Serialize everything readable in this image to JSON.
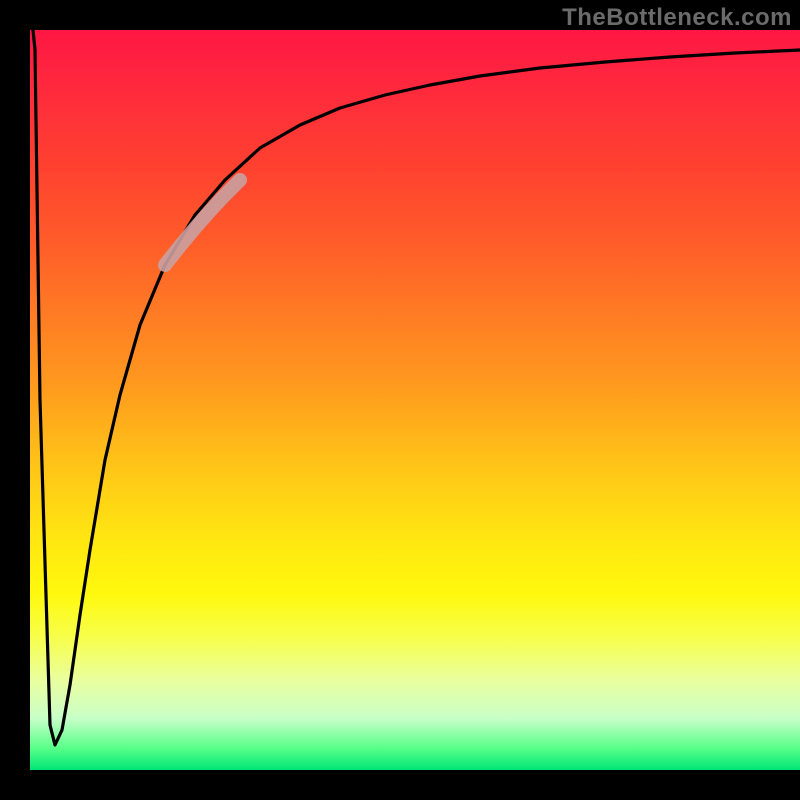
{
  "brand": {
    "watermark": "TheBottleneck.com"
  },
  "colors": {
    "background": "#000000",
    "curve": "#000000",
    "highlight": "#caa0a0",
    "gradient_top": "#ff1744",
    "gradient_mid": "#ffeb3b",
    "gradient_bottom": "#00e676"
  },
  "chart_data": {
    "type": "line",
    "title": "",
    "xlabel": "",
    "ylabel": "",
    "xlim": [
      0,
      100
    ],
    "ylim": [
      0,
      100
    ],
    "grid": false,
    "legend": false,
    "series": [
      {
        "name": "bottleneck-curve",
        "x": [
          0.5,
          1,
          2,
          3,
          4,
          5,
          6,
          8,
          10,
          12,
          15,
          18,
          22,
          26,
          30,
          35,
          40,
          45,
          50,
          56,
          62,
          70,
          78,
          86,
          94,
          100
        ],
        "y": [
          100,
          50,
          6,
          4,
          12,
          22,
          30,
          42,
          51,
          58,
          66,
          71,
          77,
          81,
          84,
          87,
          89,
          90.5,
          92,
          93,
          94,
          95,
          95.8,
          96.4,
          96.9,
          97.2
        ]
      }
    ],
    "highlight_segment": {
      "series": "bottleneck-curve",
      "x_range": [
        18,
        27
      ],
      "note": "thicker pale stroke overlay"
    },
    "note": "Background is a vertical gradient from red (y≈100) through orange/yellow to green (y≈0); values approximate as no axis ticks are visible."
  }
}
